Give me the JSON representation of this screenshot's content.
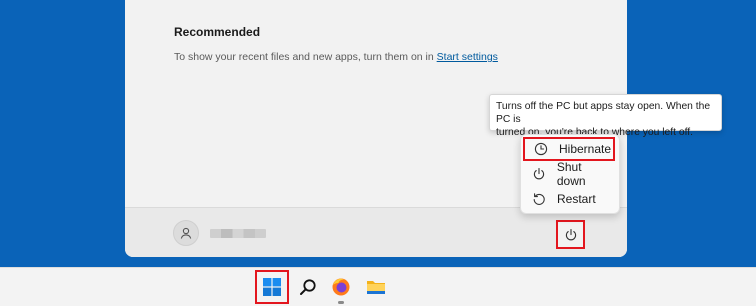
{
  "start_menu": {
    "recommended": {
      "title": "Recommended",
      "text": "To show your recent files and new apps, turn them on in ",
      "link": "Start settings"
    }
  },
  "tooltip": {
    "line1": "Turns off the PC but apps stay open. When the PC is",
    "line2": "turned on, you're back to where you left off."
  },
  "power_menu": {
    "items": [
      {
        "label": "Hibernate",
        "icon": "clock-icon",
        "highlighted": true
      },
      {
        "label": "Shut down",
        "icon": "power-icon"
      },
      {
        "label": "Restart",
        "icon": "restart-icon"
      }
    ]
  },
  "footer": {
    "power_button_icon": "power-icon",
    "user_icon": "user-icon"
  },
  "taskbar": {
    "items": [
      {
        "name": "start",
        "icon": "windows-logo-icon"
      },
      {
        "name": "search",
        "icon": "search-icon"
      },
      {
        "name": "firefox",
        "icon": "firefox-icon"
      },
      {
        "name": "file-explorer",
        "icon": "folder-icon"
      }
    ]
  },
  "colors": {
    "desktop": "#0a63b8",
    "highlight_border": "#e3161e",
    "link": "#005a9e"
  }
}
